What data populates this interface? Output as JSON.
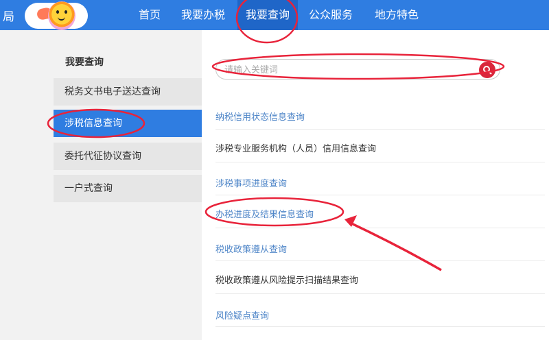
{
  "header": {
    "brand_char": "局",
    "nav": [
      "首页",
      "我要办税",
      "我要查询",
      "公众服务",
      "地方特色"
    ],
    "active_nav": "我要查询"
  },
  "sidebar": {
    "title": "我要查询",
    "items": [
      {
        "label": "税务文书电子送达查询"
      },
      {
        "label": "涉税信息查询",
        "active": true
      },
      {
        "label": "委托代征协议查询"
      },
      {
        "label": "一户式查询"
      }
    ]
  },
  "search": {
    "placeholder": "请输入关键词"
  },
  "links": [
    {
      "label": "纳税信用状态信息查询",
      "style": "blue"
    },
    {
      "label": "涉税专业服务机构（人员）信用信息查询",
      "style": "dark"
    },
    {
      "label": "涉税事项进度查询",
      "style": "blue"
    },
    {
      "label": "办税进度及结果信息查询",
      "style": "blue"
    },
    {
      "label": "税收政策遵从查询",
      "style": "blue"
    },
    {
      "label": "税收政策遵从风险提示扫描结果查询",
      "style": "dark"
    },
    {
      "label": "风险疑点查询",
      "style": "blue"
    }
  ],
  "colors": {
    "nav_bg": "#2f7de1",
    "active_bg": "#1f66c8",
    "annotation_red": "#e8233a",
    "search_button": "#d9263b"
  },
  "icons": {
    "search_button": "search-icon"
  }
}
